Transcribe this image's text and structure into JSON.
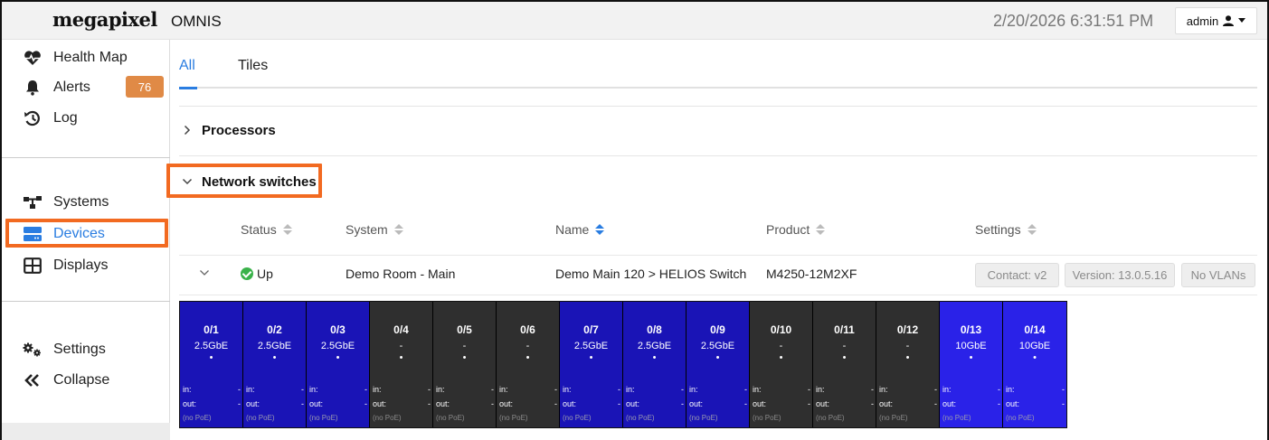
{
  "header": {
    "logo": "megapixel",
    "app_title": "OMNIS",
    "datetime": "2/20/2026 6:31:51 PM",
    "user_label": "admin"
  },
  "sidebar": {
    "top_items": [
      {
        "label": "Health Map",
        "icon": "heartbeat-icon"
      },
      {
        "label": "Alerts",
        "icon": "bell-icon",
        "badge": "76"
      },
      {
        "label": "Log",
        "icon": "history-icon"
      }
    ],
    "mid_items": [
      {
        "label": "Systems",
        "icon": "network-icon"
      },
      {
        "label": "Devices",
        "icon": "server-icon",
        "active": true
      },
      {
        "label": "Displays",
        "icon": "grid-icon"
      }
    ],
    "bottom_items": [
      {
        "label": "Settings",
        "icon": "gears-icon"
      },
      {
        "label": "Collapse",
        "icon": "double-chevron-left-icon"
      }
    ]
  },
  "tabs": [
    {
      "label": "All",
      "active": true
    },
    {
      "label": "Tiles",
      "active": false
    }
  ],
  "sections": {
    "processors": "Processors",
    "network_switches": "Network switches"
  },
  "table": {
    "headers": [
      "Status",
      "System",
      "Name",
      "Product",
      "Settings"
    ],
    "row": {
      "status": "Up",
      "system": "Demo Room - Main",
      "name": "Demo Main 120 > HELIOS Switch",
      "product": "M4250-12M2XF",
      "settings": [
        "Contact: v2",
        "Version: 13.0.5.16",
        "No VLANs"
      ]
    }
  },
  "ports": [
    {
      "id": "0/1",
      "speed": "2.5GbE",
      "state": "up"
    },
    {
      "id": "0/2",
      "speed": "2.5GbE",
      "state": "up"
    },
    {
      "id": "0/3",
      "speed": "2.5GbE",
      "state": "up"
    },
    {
      "id": "0/4",
      "speed": "-",
      "state": "down"
    },
    {
      "id": "0/5",
      "speed": "-",
      "state": "down"
    },
    {
      "id": "0/6",
      "speed": "-",
      "state": "down"
    },
    {
      "id": "0/7",
      "speed": "2.5GbE",
      "state": "up"
    },
    {
      "id": "0/8",
      "speed": "2.5GbE",
      "state": "up"
    },
    {
      "id": "0/9",
      "speed": "2.5GbE",
      "state": "up"
    },
    {
      "id": "0/10",
      "speed": "-",
      "state": "down"
    },
    {
      "id": "0/11",
      "speed": "-",
      "state": "down"
    },
    {
      "id": "0/12",
      "speed": "-",
      "state": "down"
    },
    {
      "id": "0/13",
      "speed": "10GbE",
      "state": "sfp"
    },
    {
      "id": "0/14",
      "speed": "10GbE",
      "state": "sfp"
    }
  ],
  "port_labels": {
    "dot": "•",
    "in": "in:",
    "out": "out:",
    "dash": "-",
    "poe": "(no PoE)"
  },
  "colors": {
    "accent": "#2a7de1",
    "highlight": "#f26a21",
    "badge": "#e08a46",
    "status_ok": "#3ab24a",
    "port_up": "#1a14b6",
    "port_down": "#2f2f2f",
    "port_sfp": "#2a22e8"
  }
}
